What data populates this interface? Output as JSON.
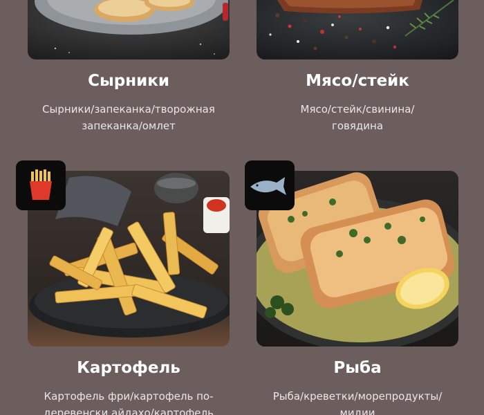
{
  "categories": [
    {
      "title": "Сырники",
      "description": "Сырники/запеканка/творожная запеканка/омлет",
      "desc_lines": [
        "Сырники/запеканка/творожная",
        "запеканка/омлет"
      ],
      "icon": "none"
    },
    {
      "title": "Мясо/стейк",
      "description": "Мясо/стейк/свинина/говядина",
      "desc_lines": [
        "Мясо/стейк/свинина/",
        "говядина"
      ],
      "icon": "none"
    },
    {
      "title": "Картофель",
      "description": "Картофель фри/картофель по-деревенски айдахо/картофель",
      "desc_lines": [
        "Картофель фри/картофель по-",
        "деревенски айдахо/картофель"
      ],
      "icon": "french-fries-icon"
    },
    {
      "title": "Рыба",
      "description": "Рыба/креветки/морепродукты/мидии",
      "desc_lines": [
        "Рыба/креветки/морепродукты/",
        "мидии"
      ],
      "icon": "fish-icon"
    }
  ],
  "colors": {
    "background": "#6d5e5e",
    "text": "#ffffff",
    "badge": "#0b0b0b",
    "fries_red": "#e0392b",
    "fries_yellow": "#f5c542"
  }
}
